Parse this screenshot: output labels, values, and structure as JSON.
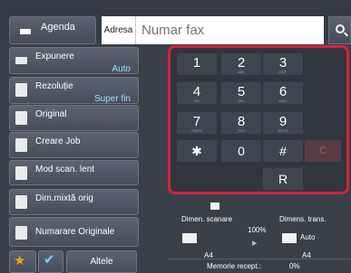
{
  "header": {
    "agenda_label": "Agenda",
    "destination_label": "Adresa",
    "fax_placeholder": "Numar fax"
  },
  "sidebar": {
    "items": [
      {
        "label": "Expunere",
        "value": "Auto"
      },
      {
        "label": "Rezoluție",
        "value": "Super fin"
      },
      {
        "label": "Original"
      },
      {
        "label": "Creare Job"
      },
      {
        "label": "Mod scan. lent"
      },
      {
        "label": "Dim.mixtă orig"
      },
      {
        "label": "Numarare Originale"
      }
    ],
    "more_label": "Altele"
  },
  "keypad": {
    "keys": [
      {
        "digit": "1",
        "letters": ""
      },
      {
        "digit": "2",
        "letters": "ABC"
      },
      {
        "digit": "3",
        "letters": "DEF"
      },
      {
        "digit": "4",
        "letters": "GHI"
      },
      {
        "digit": "5",
        "letters": "JKL"
      },
      {
        "digit": "6",
        "letters": "MNO"
      },
      {
        "digit": "7",
        "letters": "PQRS"
      },
      {
        "digit": "8",
        "letters": "TUV"
      },
      {
        "digit": "9",
        "letters": "WXYZ"
      },
      {
        "digit": "✱",
        "letters": ""
      },
      {
        "digit": "0",
        "letters": ""
      },
      {
        "digit": "#",
        "letters": ""
      },
      {
        "digit": "C",
        "letters": ""
      },
      {
        "digit": "R",
        "letters": ""
      }
    ]
  },
  "status": {
    "scan_size_label": "Dimen. scanare",
    "send_size_label": "Dimens. trans.",
    "ratio": "100%",
    "auto_label": "Auto",
    "scan_paper": "A4",
    "send_paper": "A4",
    "memory_label": "Memorie recept.:",
    "memory_value": "0%"
  },
  "colors": {
    "highlight_border": "#d8213c",
    "value_text": "#9fe0ff",
    "star": "#f2a01a"
  }
}
